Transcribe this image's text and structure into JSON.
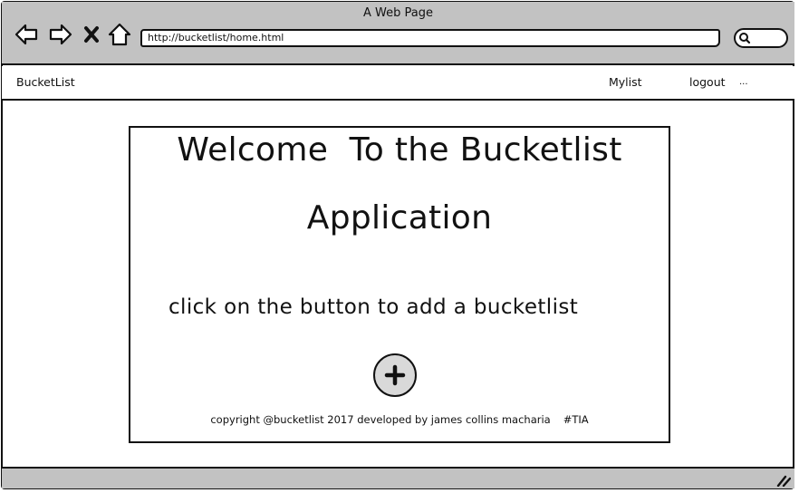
{
  "window": {
    "title": "A Web Page"
  },
  "browser": {
    "url": "http://bucketlist/home.html",
    "icons": [
      "back-arrow-icon",
      "forward-arrow-icon",
      "close-icon",
      "home-icon",
      "search-icon",
      "resize-grip-icon"
    ]
  },
  "navbar": {
    "brand": "BucketList",
    "items": [
      {
        "label": "Mylist"
      },
      {
        "label": "logout"
      },
      {
        "label": "..."
      }
    ]
  },
  "main": {
    "title_line1": "Welcome  To the Bucketlist",
    "title_line2": "Application",
    "instruction": "click on the button to add a bucketlist",
    "add_button_icon": "plus-icon",
    "footer_text": "copyright @bucketlist 2017 developed by james collins macharia",
    "footer_tag": "#TIA"
  },
  "colors": {
    "chrome": "#c2c2c2",
    "ink": "#111111",
    "button_fill": "#d9d9d9"
  }
}
